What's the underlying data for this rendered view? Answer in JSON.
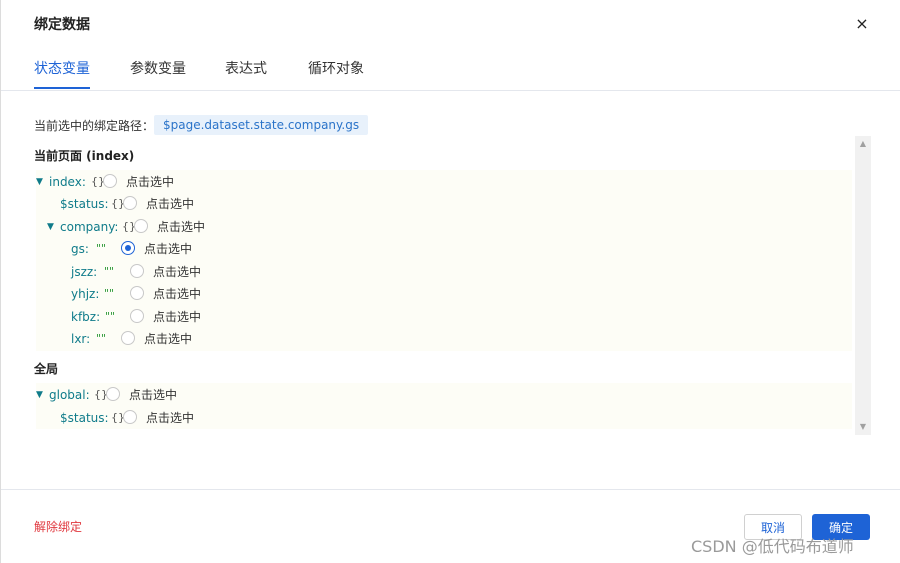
{
  "dialog": {
    "title": "绑定数据",
    "close_icon": "×"
  },
  "tabs": [
    {
      "label": "状态变量",
      "active": true
    },
    {
      "label": "参数变量",
      "active": false
    },
    {
      "label": "表达式",
      "active": false
    },
    {
      "label": "循环对象",
      "active": false
    }
  ],
  "path": {
    "label": "当前选中的绑定路径：",
    "value": "$page.dataset.state.company.gs"
  },
  "sections": {
    "page": {
      "title": "当前页面 (index)",
      "rows": {
        "index": {
          "key": "index:",
          "type": "{}",
          "radio_label": "点击选中",
          "expanded": true
        },
        "status": {
          "key": "$status:",
          "type": "{}",
          "radio_label": "点击选中"
        },
        "company": {
          "key": "company:",
          "type": "{}",
          "radio_label": "点击选中",
          "expanded": true
        },
        "gs": {
          "key": "gs:",
          "type": "\"\"",
          "radio_label": "点击选中",
          "checked": true
        },
        "jszz": {
          "key": "jszz:",
          "type": "\"\"",
          "radio_label": "点击选中"
        },
        "yhjz": {
          "key": "yhjz:",
          "type": "\"\"",
          "radio_label": "点击选中"
        },
        "kfbz": {
          "key": "kfbz:",
          "type": "\"\"",
          "radio_label": "点击选中"
        },
        "lxr": {
          "key": "lxr:",
          "type": "\"\"",
          "radio_label": "点击选中"
        }
      }
    },
    "global": {
      "title": "全局",
      "rows": {
        "global": {
          "key": "global:",
          "type": "{}",
          "radio_label": "点击选中",
          "expanded": true
        },
        "status": {
          "key": "$status:",
          "type": "{}",
          "radio_label": "点击选中"
        }
      }
    }
  },
  "footer": {
    "unbind": "解除绑定",
    "cancel": "取消",
    "ok": "确定"
  },
  "icons": {
    "expand": "▼",
    "scroll_up": "▲",
    "scroll_down": "▼"
  },
  "watermark": "CSDN @低代码布道师",
  "colors": {
    "accent": "#1e63d6",
    "danger": "#e0383e",
    "key": "#0f7b8a",
    "string_type": "#2e9b3a",
    "path_bg": "#e8f1fb"
  }
}
